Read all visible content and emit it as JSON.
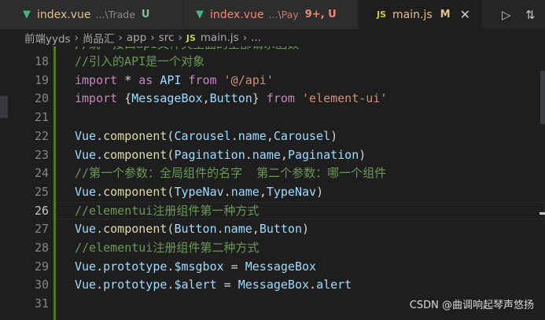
{
  "tabs": [
    {
      "name": "index.vue",
      "dir": "...\\Trade",
      "status": "U",
      "name_color": "#e2c08d",
      "status_color": "#73c991",
      "icon": "vue-icon"
    },
    {
      "name": "index.vue",
      "dir": "...\\Pay",
      "status": "9+, U",
      "name_color": "#f48771",
      "status_color": "#f48771",
      "icon": "vue-icon"
    },
    {
      "name": "main.js",
      "dir": "",
      "status": "M",
      "name_color": "#e2c08d",
      "status_color": "#e2c08d",
      "icon": "js-icon",
      "icon_label": "JS",
      "close": "✕"
    }
  ],
  "actions": [
    {
      "icon": "run-icon",
      "glyph": "▷"
    },
    {
      "icon": "compare-changes-icon",
      "glyph": "⇅"
    }
  ],
  "breadcrumb": {
    "items": [
      "前端yyds",
      "尚品汇",
      "app",
      "src"
    ],
    "file_icon": "JS",
    "file": "main.js",
    "tail": "..."
  },
  "editor": {
    "first_line_partial": "//统一接口api文件夹里面的全部请求函数",
    "lines": [
      {
        "no": "18",
        "tokens": [
          {
            "t": "//引入的API是一个对象",
            "c": "c-comment"
          }
        ]
      },
      {
        "no": "19",
        "tokens": [
          {
            "t": "import",
            "c": "c-kw"
          },
          {
            "t": " * ",
            "c": "c-plain"
          },
          {
            "t": "as",
            "c": "c-kw"
          },
          {
            "t": " API ",
            "c": "c-var"
          },
          {
            "t": "from",
            "c": "c-kw"
          },
          {
            "t": " ",
            "c": "c-plain"
          },
          {
            "t": "'@/api'",
            "c": "c-str"
          }
        ]
      },
      {
        "no": "20",
        "tokens": [
          {
            "t": "import",
            "c": "c-kw"
          },
          {
            "t": " {",
            "c": "c-plain"
          },
          {
            "t": "MessageBox",
            "c": "c-var"
          },
          {
            "t": ",",
            "c": "c-plain"
          },
          {
            "t": "Button",
            "c": "c-var"
          },
          {
            "t": "} ",
            "c": "c-plain"
          },
          {
            "t": "from",
            "c": "c-kw"
          },
          {
            "t": " ",
            "c": "c-plain"
          },
          {
            "t": "'element-ui'",
            "c": "c-str"
          }
        ]
      },
      {
        "no": "21",
        "tokens": []
      },
      {
        "no": "22",
        "tokens": [
          {
            "t": "Vue",
            "c": "c-var"
          },
          {
            "t": ".",
            "c": "c-plain"
          },
          {
            "t": "component",
            "c": "c-fn"
          },
          {
            "t": "(",
            "c": "c-plain"
          },
          {
            "t": "Carousel",
            "c": "c-var"
          },
          {
            "t": ".",
            "c": "c-plain"
          },
          {
            "t": "name",
            "c": "c-var"
          },
          {
            "t": ",",
            "c": "c-plain"
          },
          {
            "t": "Carousel",
            "c": "c-var"
          },
          {
            "t": ")",
            "c": "c-plain"
          }
        ]
      },
      {
        "no": "23",
        "tokens": [
          {
            "t": "Vue",
            "c": "c-var"
          },
          {
            "t": ".",
            "c": "c-plain"
          },
          {
            "t": "component",
            "c": "c-fn"
          },
          {
            "t": "(",
            "c": "c-plain"
          },
          {
            "t": "Pagination",
            "c": "c-var"
          },
          {
            "t": ".",
            "c": "c-plain"
          },
          {
            "t": "name",
            "c": "c-var"
          },
          {
            "t": ",",
            "c": "c-plain"
          },
          {
            "t": "Pagination",
            "c": "c-var"
          },
          {
            "t": ")",
            "c": "c-plain"
          }
        ]
      },
      {
        "no": "24",
        "tokens": [
          {
            "t": "//第一个参数：全局组件的名字  第二个参数：哪一个组件",
            "c": "c-comment"
          }
        ]
      },
      {
        "no": "25",
        "tokens": [
          {
            "t": "Vue",
            "c": "c-var"
          },
          {
            "t": ".",
            "c": "c-plain"
          },
          {
            "t": "component",
            "c": "c-fn"
          },
          {
            "t": "(",
            "c": "c-plain"
          },
          {
            "t": "TypeNav",
            "c": "c-var"
          },
          {
            "t": ".",
            "c": "c-plain"
          },
          {
            "t": "name",
            "c": "c-var"
          },
          {
            "t": ",",
            "c": "c-plain"
          },
          {
            "t": "TypeNav",
            "c": "c-var"
          },
          {
            "t": ")",
            "c": "c-plain"
          }
        ]
      },
      {
        "no": "26",
        "current": true,
        "tokens": [
          {
            "t": "//elementui注册组件第一种方式",
            "c": "c-comment"
          }
        ]
      },
      {
        "no": "27",
        "tokens": [
          {
            "t": "Vue",
            "c": "c-var"
          },
          {
            "t": ".",
            "c": "c-plain"
          },
          {
            "t": "component",
            "c": "c-fn"
          },
          {
            "t": "(",
            "c": "c-plain"
          },
          {
            "t": "Button",
            "c": "c-var"
          },
          {
            "t": ".",
            "c": "c-plain"
          },
          {
            "t": "name",
            "c": "c-var"
          },
          {
            "t": ",",
            "c": "c-plain"
          },
          {
            "t": "Button",
            "c": "c-var"
          },
          {
            "t": ")",
            "c": "c-plain"
          }
        ]
      },
      {
        "no": "28",
        "tokens": [
          {
            "t": "//elementui注册组件第二种方式",
            "c": "c-comment"
          }
        ]
      },
      {
        "no": "29",
        "tokens": [
          {
            "t": "Vue",
            "c": "c-var"
          },
          {
            "t": ".",
            "c": "c-plain"
          },
          {
            "t": "prototype",
            "c": "c-var"
          },
          {
            "t": ".",
            "c": "c-plain"
          },
          {
            "t": "$msgbox",
            "c": "c-var"
          },
          {
            "t": " = ",
            "c": "c-plain"
          },
          {
            "t": "MessageBox",
            "c": "c-var"
          }
        ]
      },
      {
        "no": "30",
        "tokens": [
          {
            "t": "Vue",
            "c": "c-var"
          },
          {
            "t": ".",
            "c": "c-plain"
          },
          {
            "t": "prototype",
            "c": "c-var"
          },
          {
            "t": ".",
            "c": "c-plain"
          },
          {
            "t": "$alert",
            "c": "c-var"
          },
          {
            "t": " = ",
            "c": "c-plain"
          },
          {
            "t": "MessageBox",
            "c": "c-var"
          },
          {
            "t": ".",
            "c": "c-plain"
          },
          {
            "t": "alert",
            "c": "c-var"
          }
        ]
      },
      {
        "no": "31",
        "tokens": []
      }
    ]
  },
  "watermark": "CSDN @曲调响起琴声悠扬"
}
